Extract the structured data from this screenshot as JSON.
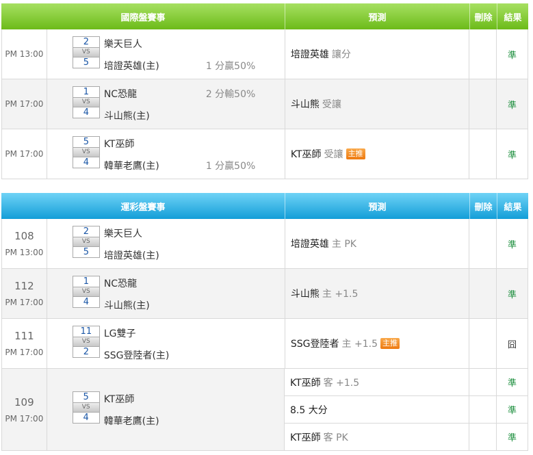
{
  "international": {
    "header": {
      "game": "國際盤賽事",
      "prediction": "預測",
      "delete": "刪除",
      "result": "結果"
    },
    "rows": [
      {
        "time": "PM 13:00",
        "score_top": "2",
        "vs": "VS",
        "score_bottom": "5",
        "team_top": "樂天巨人",
        "team_bottom": "培證英雄(主)",
        "odds_top": "",
        "odds_bottom": "1 分贏50%",
        "pred_team": "培證英雄",
        "pred_detail": "讓分",
        "pred_tag": "",
        "result": "準"
      },
      {
        "time": "PM 17:00",
        "score_top": "1",
        "vs": "VS",
        "score_bottom": "4",
        "team_top": "NC恐龍",
        "team_bottom": "斗山熊(主)",
        "odds_top": "2 分輸50%",
        "odds_bottom": "",
        "pred_team": "斗山熊",
        "pred_detail": "受讓",
        "pred_tag": "",
        "result": "準"
      },
      {
        "time": "PM 17:00",
        "score_top": "5",
        "vs": "VS",
        "score_bottom": "4",
        "team_top": "KT巫師",
        "team_bottom": "韓華老鷹(主)",
        "odds_top": "",
        "odds_bottom": "1 分贏50%",
        "pred_team": "KT巫師",
        "pred_detail": "受讓",
        "pred_tag": "主推",
        "result": "準"
      }
    ]
  },
  "lottery": {
    "header": {
      "game": "運彩盤賽事",
      "prediction": "預測",
      "delete": "刪除",
      "result": "結果"
    },
    "rows": [
      {
        "num": "108",
        "time": "PM 13:00",
        "score_top": "2",
        "vs": "VS",
        "score_bottom": "5",
        "team_top": "樂天巨人",
        "team_bottom": "培證英雄(主)",
        "pred_team": "培證英雄",
        "pred_detail": "主 PK",
        "pred_tag": "",
        "result": "準"
      },
      {
        "num": "112",
        "time": "PM 17:00",
        "score_top": "1",
        "vs": "VS",
        "score_bottom": "4",
        "team_top": "NC恐龍",
        "team_bottom": "斗山熊(主)",
        "pred_team": "斗山熊",
        "pred_detail": "主 +1.5",
        "pred_tag": "",
        "result": "準"
      },
      {
        "num": "111",
        "time": "PM 17:00",
        "score_top": "11",
        "vs": "VS",
        "score_bottom": "2",
        "team_top": "LG雙子",
        "team_bottom": "SSG登陸者(主)",
        "pred_team": "SSG登陸者",
        "pred_detail": "主 +1.5",
        "pred_tag": "主推",
        "result": "囧"
      },
      {
        "num": "109",
        "time": "PM 17:00",
        "score_top": "5",
        "vs": "VS",
        "score_bottom": "4",
        "team_top": "KT巫師",
        "team_bottom": "韓華老鷹(主)",
        "preds": [
          {
            "pred_team": "KT巫師",
            "pred_detail": "客 +1.5",
            "result": "準"
          },
          {
            "pred_team": "8.5 大分",
            "pred_detail": "",
            "result": "準"
          },
          {
            "pred_team": "KT巫師",
            "pred_detail": "客 PK",
            "result": "準"
          }
        ]
      }
    ]
  },
  "colors": {
    "green_header": "#6cbb19",
    "blue_header": "#139ed8",
    "result_ok": "#1b8e3c",
    "tag_orange": "#ee7a10"
  }
}
